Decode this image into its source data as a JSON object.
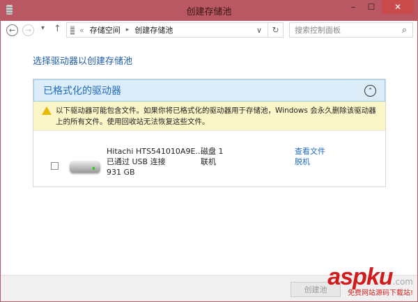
{
  "window": {
    "title": "创建存储池",
    "minimize": "–",
    "maximize": "☐",
    "close": "✕"
  },
  "address": {
    "back": "←",
    "forward": "→",
    "dropdown": "▾",
    "up": "↑",
    "crumb_sep": "«",
    "crumbs": [
      "存储空间",
      "创建存储池"
    ],
    "arrow": "▸",
    "expand": "∨",
    "refresh": "↻",
    "search_placeholder": "搜索控制面板",
    "search_icon": "⌕"
  },
  "page": {
    "heading": "选择驱动器以创建存储池"
  },
  "group": {
    "title": "已格式化的驱动器",
    "collapse": "⌃",
    "warning": "以下驱动器可能包含文件。如果你将已格式化的驱动器用于存储池，Windows 会永久删除该驱动器上的所有文件。使用回收站无法恢复这些文件。",
    "drives": [
      {
        "name": "Hitachi HTS541010A9E...",
        "connection": "已通过 USB 连接",
        "size": "931 GB",
        "disk": "磁盘 1",
        "status": "联机",
        "view_files": "查看文件",
        "offline": "脱机"
      }
    ]
  },
  "footer": {
    "create": "创建池"
  },
  "watermark": {
    "logo": "aspku",
    "suffix": ".com",
    "tagline": "免费网站源码下载站!"
  }
}
